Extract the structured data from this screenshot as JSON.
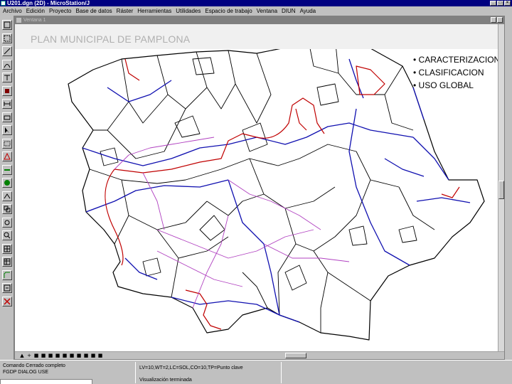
{
  "app": {
    "title": "U201.dgn (2D) - MicroStation/J",
    "window_buttons": [
      "_",
      "□",
      "×"
    ]
  },
  "menu": [
    "Archivo",
    "Edición",
    "Proyecto",
    "Base de datos",
    "Ráster",
    "Herramientas",
    "Utilidades",
    "Espacio de trabajo",
    "Ventana",
    "DIUN",
    "Ayuda"
  ],
  "view": {
    "title": "Ventana 1",
    "banner_title": "PLAN MUNICIPAL DE PAMPLONA",
    "bullets": [
      "• CARACTERIZACION",
      "• CLASIFICACION",
      "• USO GLOBAL"
    ],
    "view_control_glyphs": [
      "▲",
      "+",
      "■",
      "■",
      "■",
      "■",
      "■",
      "■",
      "■",
      "■",
      "■",
      "■"
    ]
  },
  "tools": [
    {
      "icon": "select-element-icon"
    },
    {
      "icon": "fence-icon"
    },
    {
      "icon": "line-icon"
    },
    {
      "icon": "arc-icon"
    },
    {
      "icon": "text-icon"
    },
    {
      "icon": "cell-icon"
    },
    {
      "icon": "dimension-icon"
    },
    {
      "icon": "modify-icon"
    },
    {
      "icon": "pointer-icon"
    },
    {
      "icon": "rectangle-icon"
    },
    {
      "icon": "triangle-icon"
    },
    {
      "icon": "measure-icon"
    },
    {
      "icon": "globe-icon"
    },
    {
      "icon": "snap-icon"
    },
    {
      "icon": "copy-icon"
    },
    {
      "icon": "rotate-icon"
    },
    {
      "icon": "zoom-icon"
    },
    {
      "icon": "grid-icon"
    },
    {
      "icon": "array-icon"
    },
    {
      "icon": "chamfer-icon"
    },
    {
      "icon": "trim-icon"
    },
    {
      "icon": "delete-icon"
    }
  ],
  "status": {
    "prompt_line1": "Comando Cerrado completo",
    "prompt_line2": "FGDP DIALOG USE",
    "settings": "LV=10,WT=2,LC=SOL,CO=10,TP=Punto clave",
    "message": "Visualización terminada"
  },
  "colors": {
    "titlebar": "#000080",
    "chrome": "#c0c0c0",
    "drawing_black": "#000000",
    "drawing_blue": "#1010b0",
    "drawing_red": "#c00000",
    "drawing_magenta": "#b040c0"
  }
}
